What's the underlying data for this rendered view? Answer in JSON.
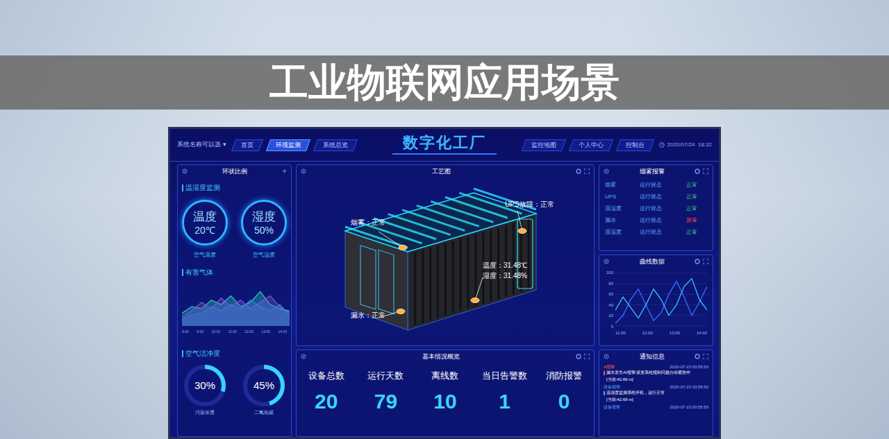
{
  "slide": {
    "title": "工业物联网应用场景"
  },
  "header": {
    "system_selector": "系统名称可以选 ▾",
    "title": "数字化工厂",
    "nav_left": [
      {
        "label": "首页",
        "selected": false
      },
      {
        "label": "环境监测",
        "selected": true
      },
      {
        "label": "系统总览",
        "selected": false
      }
    ],
    "nav_right": [
      {
        "label": "监控地图",
        "selected": false
      },
      {
        "label": "个人中心",
        "selected": false
      },
      {
        "label": "控制台",
        "selected": false
      }
    ],
    "datetime": "2020/07/24  18:32"
  },
  "ring_panel": {
    "title": "环状比例",
    "add_button": "+",
    "humiture": {
      "title": "温湿度监测",
      "gauges": [
        {
          "name": "温度",
          "value": "20℃",
          "caption": "空气温度"
        },
        {
          "name": "湿度",
          "value": "50%",
          "caption": "空气湿度"
        }
      ]
    },
    "gas": {
      "title": "有害气体",
      "x_ticks": [
        "8:00",
        "9:00",
        "10:00",
        "11:00",
        "12:00",
        "13:00",
        "14:00"
      ],
      "series": [
        {
          "values": [
            30,
            45,
            40,
            60,
            50,
            70,
            45,
            55,
            80,
            50,
            40,
            35
          ],
          "color": "#2ad0c0"
        },
        {
          "values": [
            20,
            35,
            55,
            40,
            65,
            45,
            60,
            40,
            55,
            70,
            45,
            30
          ],
          "color": "#7a5cd8"
        },
        {
          "values": [
            15,
            25,
            30,
            45,
            35,
            50,
            40,
            60,
            45,
            35,
            50,
            25
          ],
          "color": "#3a7bd5"
        }
      ]
    },
    "air": {
      "title": "空气洁净度",
      "rings": [
        {
          "value": "30%",
          "level": 0.3,
          "caption": "污染浓度"
        },
        {
          "value": "45%",
          "level": 0.45,
          "caption": "二氧化碳"
        }
      ]
    }
  },
  "process": {
    "title": "工艺图",
    "labels": [
      {
        "text": "烟雾：正常"
      },
      {
        "text": "UPS故障：正常"
      },
      {
        "text": "温度：31.48℃"
      },
      {
        "text": "湿度：31.48%"
      },
      {
        "text": "漏水：正常"
      }
    ]
  },
  "overview": {
    "title": "基本情况概览",
    "stats": [
      {
        "label": "设备总数",
        "value": "20"
      },
      {
        "label": "运行天数",
        "value": "79"
      },
      {
        "label": "离线数",
        "value": "10"
      },
      {
        "label": "当日告警数",
        "value": "1"
      },
      {
        "label": "消防报警",
        "value": "0"
      }
    ]
  },
  "alarm_panel": {
    "title": "烟雾报警",
    "rows": [
      {
        "name": "烟雾",
        "state": "运行状态",
        "status": "正常",
        "color": "#3ad16b"
      },
      {
        "name": "UPS",
        "state": "运行状态",
        "status": "正常",
        "color": "#3ad16b"
      },
      {
        "name": "温湿度",
        "state": "运行状态",
        "status": "正常",
        "color": "#3ad16b"
      },
      {
        "name": "漏水",
        "state": "运行状态",
        "status": "异常",
        "color": "#ff4a4a"
      },
      {
        "name": "温湿度",
        "state": "运行状态",
        "status": "正常",
        "color": "#3ad16b"
      }
    ]
  },
  "curve_panel": {
    "title": "曲线数据",
    "y_ticks": [
      "100",
      "80",
      "60",
      "40",
      "20",
      "0"
    ],
    "x_ticks": [
      "11:00",
      "12:00",
      "13:00",
      "14:00"
    ],
    "series": [
      {
        "values": [
          5,
          20,
          50,
          70,
          40,
          10,
          25,
          60,
          85,
          55,
          20,
          45,
          75
        ],
        "color": "#3a6cff"
      },
      {
        "values": [
          30,
          55,
          35,
          15,
          40,
          70,
          50,
          20,
          40,
          75,
          90,
          50,
          30
        ],
        "color": "#33c8ff"
      }
    ]
  },
  "notice_panel": {
    "title": "通知信息",
    "items": [
      {
        "tag": "A报警",
        "time": "2020-07-23 03:55:50",
        "text": "漏水发生AI报警  设置系统报到问题自动紧急中",
        "value": "[当前:42.69 m]",
        "color": "#ff5a5a"
      },
      {
        "tag": "设备报警",
        "time": "2020-07-23 03:55:50",
        "text": "温湿度监测系统开机，运行正常",
        "value": "[当前:42.69 m]",
        "color": "#5aa0ff"
      },
      {
        "tag": "设备报警",
        "time": "2020-07-23 03:55:50",
        "color": "#5aa0ff"
      }
    ]
  }
}
